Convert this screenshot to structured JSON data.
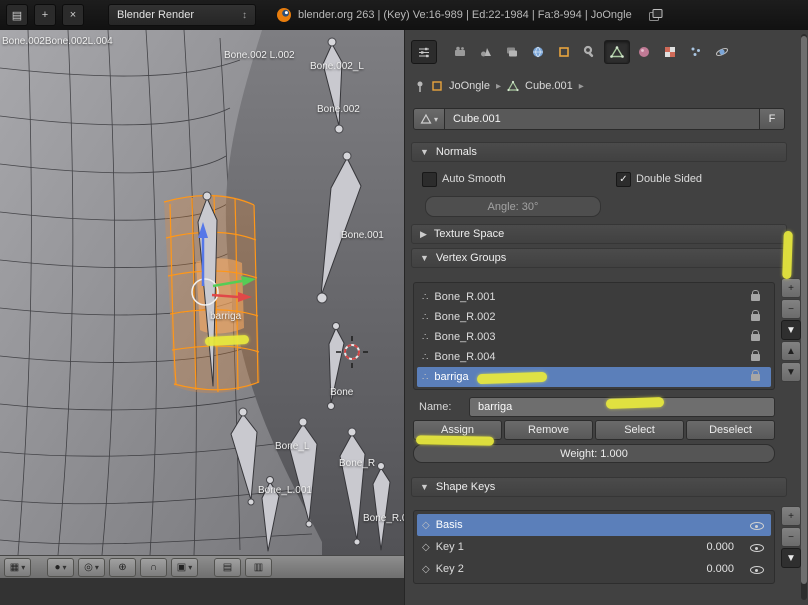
{
  "topbar": {
    "window_buttons": [
      {
        "name": "editor-type-info",
        "glyph": "▤"
      },
      {
        "name": "split-area",
        "glyph": "+"
      },
      {
        "name": "close-area",
        "glyph": "×"
      }
    ],
    "engine": "Blender Render",
    "stats": "blender.org 263 | (Key) Ve:16-989 | Ed:22-1984 | Fa:8-994 | JoOngle"
  },
  "viewport": {
    "labels": [
      {
        "text": "Bone.002Bone.002L.004"
      },
      {
        "text": "Bone.002 L.002"
      },
      {
        "text": "Bone.002_L"
      },
      {
        "text": "Bone.002"
      },
      {
        "text": "Bone.001"
      },
      {
        "text": "barriga"
      },
      {
        "text": "Bone"
      },
      {
        "text": "Bone_L"
      },
      {
        "text": "Bone_R"
      },
      {
        "text": "Bone_L.001"
      },
      {
        "text": "Bone_R.0"
      }
    ],
    "header_icons": [
      {
        "name": "editor-type-3d-view",
        "glyph": "▦"
      },
      {
        "name": "viewport-shading",
        "glyph": "●"
      },
      {
        "name": "pivot-point",
        "glyph": "◎"
      },
      {
        "name": "transform-manipulator",
        "glyph": "⊕"
      },
      {
        "name": "snap-magnet",
        "glyph": "∩"
      },
      {
        "name": "snap-element",
        "glyph": "▣"
      },
      {
        "name": "opengl-render-image",
        "glyph": "▤"
      },
      {
        "name": "opengl-render-anim",
        "glyph": "▥"
      }
    ]
  },
  "properties": {
    "tabs": [
      "Render",
      "Scene",
      "Render Layers",
      "World",
      "Object",
      "Modifiers",
      "Object Data",
      "Material",
      "Texture",
      "Particles",
      "Physics"
    ],
    "active_tab": "Object Data",
    "breadcrumb": {
      "object": "JoOngle",
      "data": "Cube.001"
    },
    "id_name": {
      "value": "Cube.001",
      "fake_user": "F"
    },
    "normals": {
      "title": "Normals",
      "auto_smooth": "Auto Smooth",
      "double_sided": "Double Sided",
      "angle": "Angle: 30°"
    },
    "texture_space": {
      "title": "Texture Space"
    },
    "vertex_groups": {
      "title": "Vertex Groups",
      "items": [
        "Bone_R.001",
        "Bone_R.002",
        "Bone_R.003",
        "Bone_R.004",
        "barriga"
      ],
      "selected": "barriga",
      "side_buttons": [
        {
          "name": "add",
          "glyph": "+"
        },
        {
          "name": "remove",
          "glyph": "−"
        },
        {
          "name": "specials-menu",
          "glyph": "▼"
        },
        {
          "name": "move-up",
          "glyph": "▲"
        },
        {
          "name": "move-down",
          "glyph": "▼"
        }
      ],
      "name_label": "Name:",
      "name_value": "barriga",
      "assign": "Assign",
      "remove": "Remove",
      "select": "Select",
      "deselect": "Deselect",
      "weight": "Weight: 1.000"
    },
    "shape_keys": {
      "title": "Shape Keys",
      "items": [
        {
          "name": "Basis",
          "value": ""
        },
        {
          "name": "Key 1",
          "value": "0.000"
        },
        {
          "name": "Key 2",
          "value": "0.000"
        }
      ],
      "selected": "Basis",
      "side_buttons": [
        {
          "name": "add",
          "glyph": "+"
        },
        {
          "name": "remove",
          "glyph": "−"
        },
        {
          "name": "specials-menu",
          "glyph": "▼"
        }
      ]
    }
  },
  "colors": {
    "selection_blue": "#5b7fba",
    "wire_orange": "#ff9718",
    "annotation_yellow": "#e9ea3d",
    "blender_orange": "#e87d0d"
  }
}
